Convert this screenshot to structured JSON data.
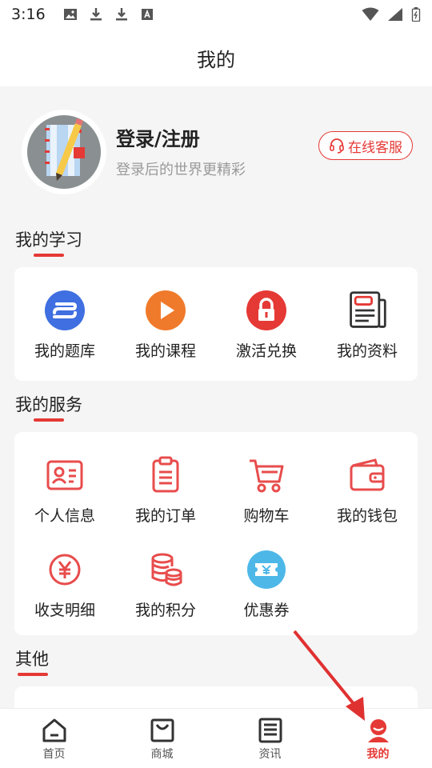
{
  "status_bar": {
    "time": "3:16",
    "left_icons": [
      "image-icon",
      "download-icon",
      "download-icon",
      "font-icon"
    ],
    "right_icons": [
      "wifi-icon",
      "signal-icon",
      "battery-icon"
    ]
  },
  "header": {
    "title": "我的"
  },
  "profile": {
    "login_title": "登录/注册",
    "login_subtitle": "登录后的世界更精彩",
    "service_button": "在线客服",
    "service_icon": "headset-icon"
  },
  "sections": {
    "study": {
      "title": "我的学习",
      "items": [
        {
          "label": "我的题库",
          "icon": "question-bank-icon"
        },
        {
          "label": "我的课程",
          "icon": "play-icon"
        },
        {
          "label": "激活兑换",
          "icon": "lock-icon"
        },
        {
          "label": "我的资料",
          "icon": "newspaper-icon"
        }
      ]
    },
    "service": {
      "title": "我的服务",
      "items": [
        {
          "label": "个人信息",
          "icon": "id-card-icon"
        },
        {
          "label": "我的订单",
          "icon": "clipboard-icon"
        },
        {
          "label": "购物车",
          "icon": "cart-icon"
        },
        {
          "label": "我的钱包",
          "icon": "wallet-icon"
        },
        {
          "label": "收支明细",
          "icon": "yen-icon"
        },
        {
          "label": "我的积分",
          "icon": "coins-icon"
        },
        {
          "label": "优惠券",
          "icon": "coupon-icon"
        }
      ]
    },
    "other": {
      "title": "其他"
    }
  },
  "bottom_nav": {
    "items": [
      {
        "label": "首页",
        "icon": "home-icon",
        "active": false
      },
      {
        "label": "商城",
        "icon": "bag-icon",
        "active": false
      },
      {
        "label": "资讯",
        "icon": "news-icon",
        "active": false
      },
      {
        "label": "我的",
        "icon": "user-icon",
        "active": true
      }
    ]
  },
  "colors": {
    "accent": "#e53935",
    "background": "#f5f5f5",
    "card": "#ffffff",
    "text": "#222222",
    "muted": "#9a9a9a"
  }
}
